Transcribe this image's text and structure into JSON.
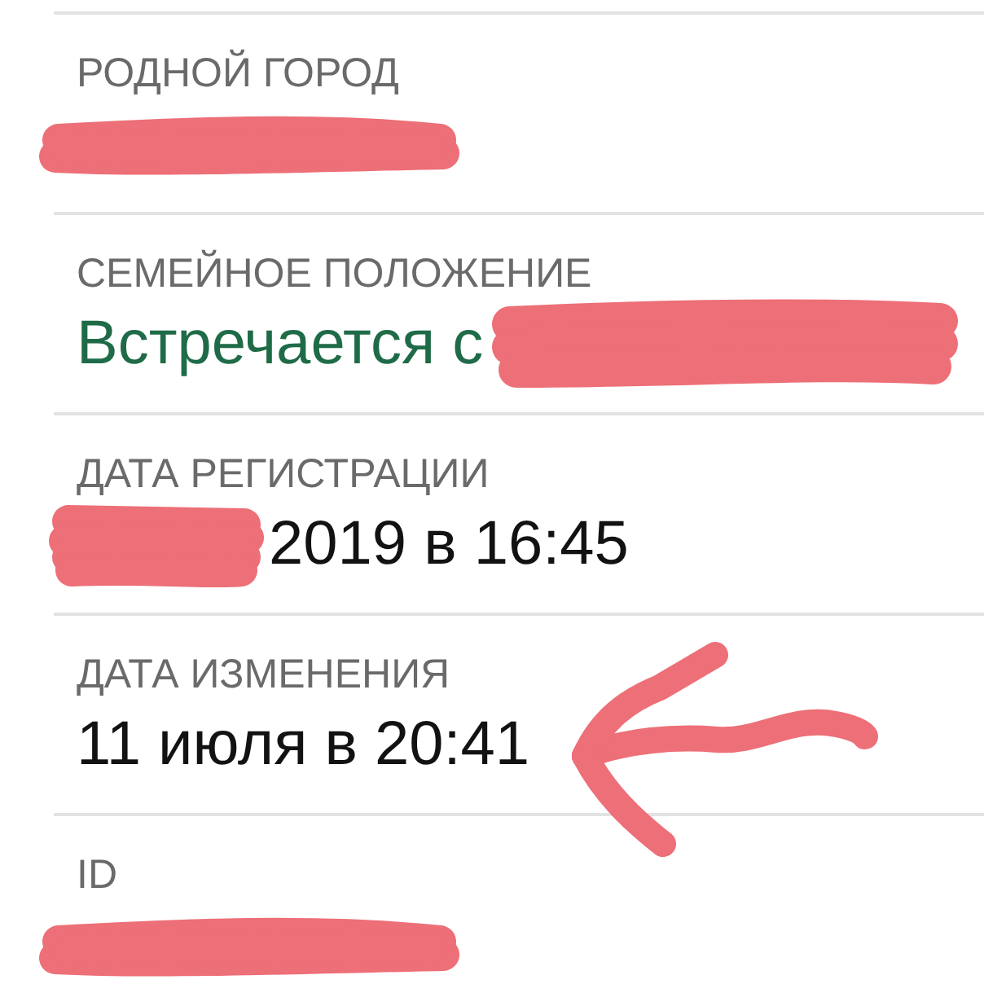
{
  "sections": [
    {
      "label": "РОДНОЙ ГОРОД",
      "value": [
        {
          "kind": "redaction"
        }
      ],
      "arrow": false
    },
    {
      "label": "СЕМЕЙНОЕ ПОЛОЖЕНИЕ",
      "value": [
        {
          "kind": "link",
          "text": "Встречается с"
        },
        {
          "kind": "redaction"
        }
      ],
      "arrow": false
    },
    {
      "label": "ДАТА РЕГИСТРАЦИИ",
      "value": [
        {
          "kind": "redaction"
        },
        {
          "kind": "text",
          "text": "2019 в 16:45"
        }
      ],
      "arrow": false
    },
    {
      "label": "ДАТА ИЗМЕНЕНИЯ",
      "value": [
        {
          "kind": "text",
          "text": "11 июля в 20:41"
        }
      ],
      "arrow": true
    },
    {
      "label": "ID",
      "value": [
        {
          "kind": "redaction"
        }
      ],
      "arrow": false
    }
  ]
}
